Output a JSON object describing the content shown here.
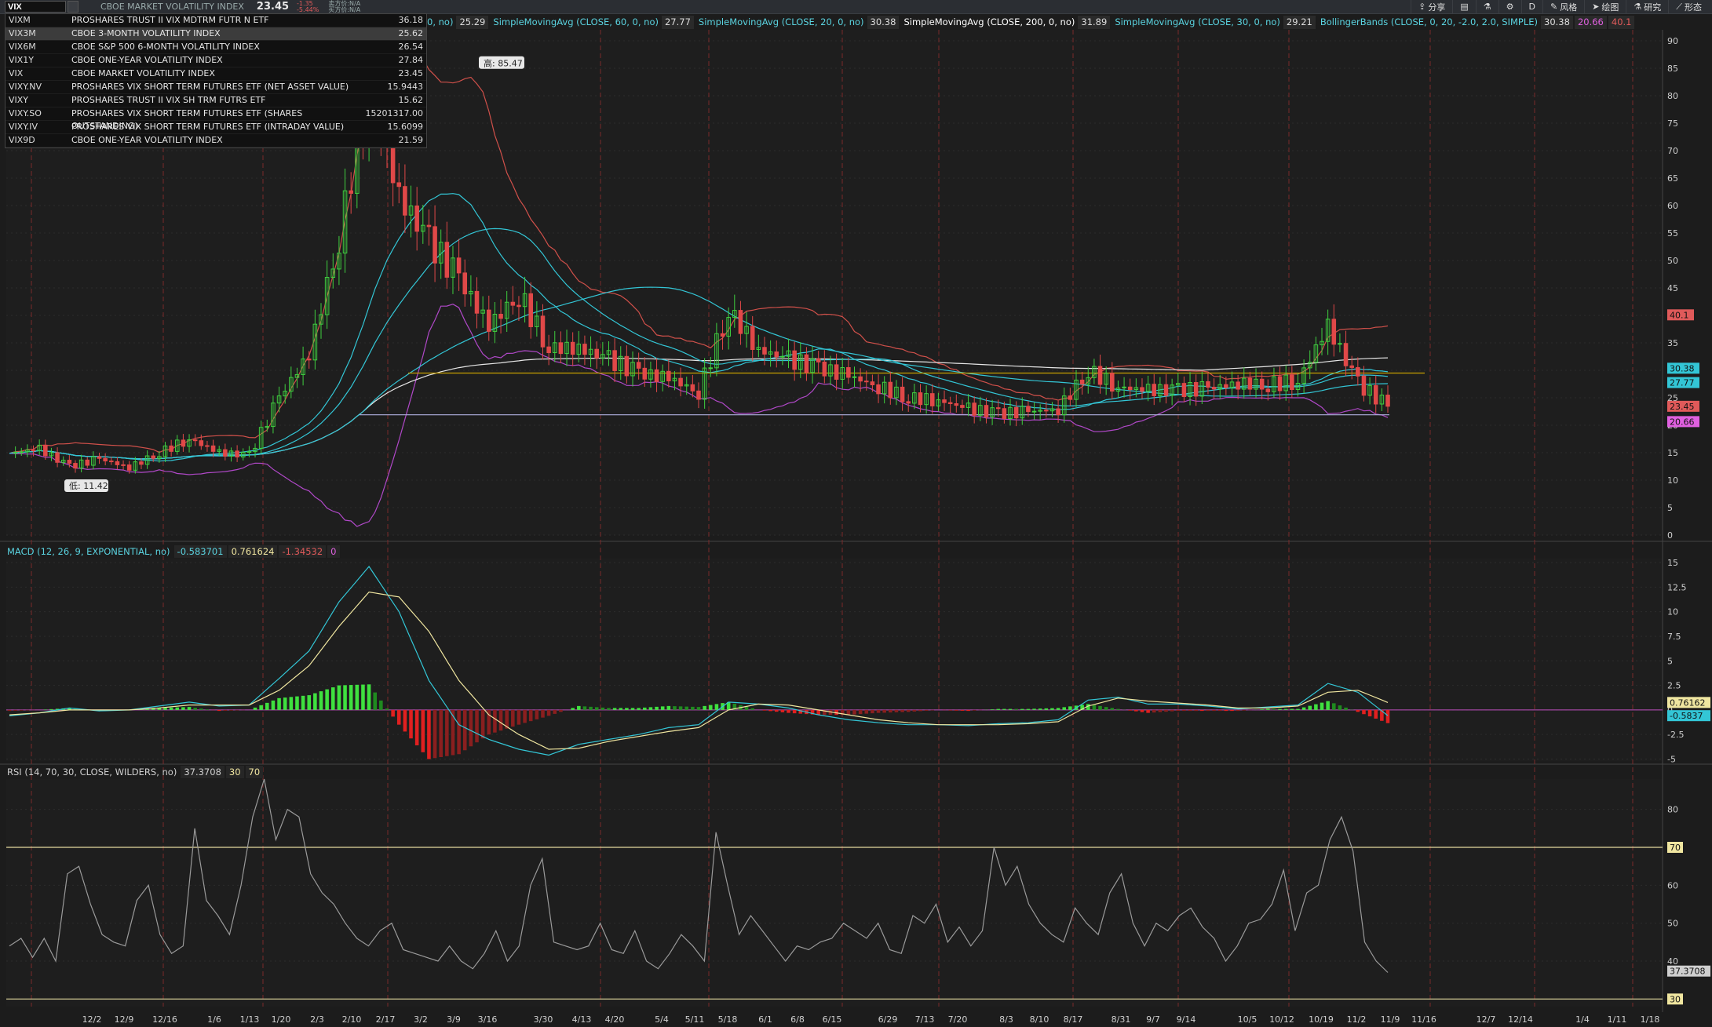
{
  "header": {
    "symbol_input": "VIX",
    "symbol_name": "CBOE MARKET VOLATILITY INDEX",
    "last_price": "23.45",
    "change": "-1.35",
    "change_pct": "-5.44%",
    "bid": "卖方价:N/A",
    "ask": "买方价:N/A",
    "buttons": [
      {
        "label": "分享",
        "icon": "share-icon"
      },
      {
        "label": "",
        "icon": "chart-icon"
      },
      {
        "label": "",
        "icon": "flask-icon"
      },
      {
        "label": "",
        "icon": "gear-icon"
      },
      {
        "label": "D",
        "icon": ""
      },
      {
        "label": "风格",
        "icon": "style-icon"
      },
      {
        "label": "绘图",
        "icon": "cursor-icon"
      },
      {
        "label": "研究",
        "icon": "flask-icon"
      },
      {
        "label": "形态",
        "icon": "pattern-icon"
      }
    ]
  },
  "symbol_list": [
    {
      "symbol": "VIXM",
      "name": "PROSHARES TRUST II VIX MDTRM FUTR N ETF",
      "value": "36.18"
    },
    {
      "symbol": "VIX3M",
      "name": "CBOE 3-MONTH VOLATILITY INDEX",
      "value": "25.62",
      "selected": true
    },
    {
      "symbol": "VIX6M",
      "name": "CBOE S&P 500 6-MONTH VOLATILITY INDEX",
      "value": "26.54"
    },
    {
      "symbol": "VIX1Y",
      "name": "CBOE ONE-YEAR VOLATILITY INDEX",
      "value": "27.84"
    },
    {
      "symbol": "VIX",
      "name": "CBOE MARKET VOLATILITY INDEX",
      "value": "23.45"
    },
    {
      "symbol": "VIXY.NV",
      "name": "PROSHARES VIX SHORT TERM FUTURES ETF (NET ASSET VALUE)",
      "value": "15.9443"
    },
    {
      "symbol": "VIXY",
      "name": "PROSHARES TRUST II VIX SH TRM FUTRS ETF",
      "value": "15.62"
    },
    {
      "symbol": "VIXY.SO",
      "name": "PROSHARES VIX SHORT TERM FUTURES ETF (SHARES OUTSTANDING)",
      "value": "15201317.00"
    },
    {
      "symbol": "VIXY.IV",
      "name": "PROSHARES VIX SHORT TERM FUTURES ETF (INTRADAY VALUE)",
      "value": "15.6099"
    },
    {
      "symbol": "VIX9D",
      "name": "CBOE ONE-YEAR VOLATILITY INDEX",
      "value": "21.59"
    }
  ],
  "study_bar": [
    {
      "text": "0, no)",
      "value": "25.29",
      "color": "#5ad3e0"
    },
    {
      "text": "SimpleMovingAvg (CLOSE, 60, 0, no)",
      "value": "27.77",
      "color": "#5ad3e0"
    },
    {
      "text": "SimpleMovingAvg (CLOSE, 20, 0, no)",
      "value": "30.38",
      "color": "#5ad3e0"
    },
    {
      "text": "SimpleMovingAvg (CLOSE, 200, 0, no)",
      "value": "31.89",
      "color": "#ffffff"
    },
    {
      "text": "SimpleMovingAvg (CLOSE, 30, 0, no)",
      "value": "29.21",
      "color": "#5ad3e0"
    },
    {
      "text": "BollingerBands (CLOSE, 0, 20, -2.0, 2.0, SIMPLE)",
      "value": "30.38",
      "color": "#5ad3e0"
    }
  ],
  "study_bar_extra": [
    {
      "value": "20.66",
      "color": "#e060e0"
    },
    {
      "value": "40.1",
      "color": "#e05a5a"
    }
  ],
  "macd_label": {
    "name": "MACD (12, 26, 9, EXPONENTIAL, no)",
    "values": [
      {
        "v": "-0.583701",
        "color": "#5ad3e0"
      },
      {
        "v": "0.761624",
        "color": "#f0e6a0"
      },
      {
        "v": "-1.34532",
        "color": "#e05a5a"
      },
      {
        "v": "0",
        "color": "#e060e0"
      }
    ]
  },
  "rsi_label": {
    "name": "RSI (14, 70, 30, CLOSE, WILDERS, no)",
    "values": [
      {
        "v": "37.3708",
        "color": "#cfcfcf"
      },
      {
        "v": "30",
        "color": "#f0e6a0"
      },
      {
        "v": "70",
        "color": "#f0e6a0"
      }
    ]
  },
  "chart_data": [
    {
      "type": "candlestick",
      "title": "VIX",
      "x_tick_labels": [
        "12/2",
        "12/9",
        "12/16",
        "1/6",
        "1/13",
        "1/20",
        "2/3",
        "2/10",
        "2/17",
        "3/2",
        "3/9",
        "3/16",
        "3/30",
        "4/13",
        "4/20",
        "5/4",
        "5/11",
        "5/18",
        "6/1",
        "6/8",
        "6/15",
        "6/29",
        "7/13",
        "7/20",
        "8/3",
        "8/10",
        "8/17",
        "8/31",
        "9/7",
        "9/14",
        "10/5",
        "10/12",
        "10/19",
        "11/2",
        "11/9",
        "11/16",
        "12/7",
        "12/14",
        "1/4",
        "1/11",
        "1/18"
      ],
      "y_ticks": [
        0,
        5,
        10,
        15,
        20,
        25,
        30,
        35,
        40,
        45,
        50,
        55,
        60,
        65,
        70,
        75,
        80,
        85,
        90
      ],
      "ylim": [
        0,
        92
      ],
      "annotations": [
        {
          "label": "高: 85.47",
          "value": 85.47
        },
        {
          "label": "低: 11.42",
          "value": 11.42
        }
      ],
      "right_badges": [
        {
          "value": "40.1",
          "color": "#e05a5a"
        },
        {
          "value": "30.38",
          "color": "#33c6d6"
        },
        {
          "value": "27.77",
          "color": "#33c6d6"
        },
        {
          "value": "23.45",
          "color": "#e05a5a"
        },
        {
          "value": "20.66",
          "color": "#e060e0"
        }
      ],
      "horizontal_lines": [
        {
          "value": 29.5,
          "color": "#c8a000"
        },
        {
          "value": 21.9,
          "color": "#b0b0e0"
        }
      ],
      "close_series": [
        {
          "x": "12/2",
          "y": 14.9
        },
        {
          "x": "12/9",
          "y": 15.7
        },
        {
          "x": "12/16",
          "y": 12.5
        },
        {
          "x": "1/6",
          "y": 13.9
        },
        {
          "x": "1/13",
          "y": 12.3
        },
        {
          "x": "1/20",
          "y": 15.0
        },
        {
          "x": "2/3",
          "y": 17.5
        },
        {
          "x": "2/10",
          "y": 15.0
        },
        {
          "x": "2/17",
          "y": 14.5
        },
        {
          "x": "2/24",
          "y": 25.0
        },
        {
          "x": "3/2",
          "y": 33.0
        },
        {
          "x": "3/9",
          "y": 54.0
        },
        {
          "x": "3/16",
          "y": 82.7
        },
        {
          "x": "3/23",
          "y": 61.6
        },
        {
          "x": "3/30",
          "y": 53.5
        },
        {
          "x": "4/6",
          "y": 46.7
        },
        {
          "x": "4/13",
          "y": 38.1
        },
        {
          "x": "4/20",
          "y": 43.8
        },
        {
          "x": "4/27",
          "y": 34.1
        },
        {
          "x": "5/4",
          "y": 34.0
        },
        {
          "x": "5/11",
          "y": 32.0
        },
        {
          "x": "5/18",
          "y": 29.5
        },
        {
          "x": "5/25",
          "y": 28.6
        },
        {
          "x": "6/1",
          "y": 26.0
        },
        {
          "x": "6/8",
          "y": 41.0
        },
        {
          "x": "6/15",
          "y": 33.7
        },
        {
          "x": "6/22",
          "y": 32.0
        },
        {
          "x": "6/29",
          "y": 30.4
        },
        {
          "x": "7/6",
          "y": 29.0
        },
        {
          "x": "7/13",
          "y": 27.0
        },
        {
          "x": "7/20",
          "y": 25.0
        },
        {
          "x": "7/27",
          "y": 24.5
        },
        {
          "x": "8/3",
          "y": 23.0
        },
        {
          "x": "8/10",
          "y": 22.1
        },
        {
          "x": "8/17",
          "y": 22.5
        },
        {
          "x": "8/24",
          "y": 22.9
        },
        {
          "x": "8/31",
          "y": 30.0
        },
        {
          "x": "9/7",
          "y": 26.9
        },
        {
          "x": "9/14",
          "y": 26.4
        },
        {
          "x": "9/21",
          "y": 26.4
        },
        {
          "x": "9/28",
          "y": 26.7
        },
        {
          "x": "10/5",
          "y": 27.6
        },
        {
          "x": "10/12",
          "y": 27.4
        },
        {
          "x": "10/19",
          "y": 28.0
        },
        {
          "x": "10/26",
          "y": 38.0
        },
        {
          "x": "11/2",
          "y": 27.6
        },
        {
          "x": "11/9",
          "y": 23.45
        }
      ]
    },
    {
      "type": "line",
      "title": "MACD (12, 26, 9, EXPONENTIAL, no)",
      "y_ticks": [
        -5,
        -2.5,
        0,
        2.5,
        5,
        7.5,
        10,
        12.5,
        15
      ],
      "ylim": [
        -5.2,
        15.4
      ],
      "right_badges": [
        {
          "value": "0.76162",
          "color": "#f0e6a0"
        },
        {
          "value": "-0.5837",
          "color": "#33c6d6"
        }
      ],
      "series": [
        {
          "name": "Value",
          "values": [
            -0.6,
            -0.3,
            0.2,
            -0.1,
            0.0,
            0.4,
            0.8,
            0.4,
            0.5,
            3.2,
            6.0,
            11.0,
            14.6,
            10.0,
            3.0,
            -1.5,
            -3.0,
            -4.0,
            -4.6,
            -3.5,
            -3.0,
            -2.5,
            -1.8,
            -1.5,
            0.8,
            0.6,
            0.2,
            -0.5,
            -1.0,
            -1.3,
            -1.5,
            -1.5,
            -1.6,
            -1.4,
            -1.3,
            -1.0,
            1.0,
            1.3,
            0.6,
            0.6,
            0.4,
            0.1,
            0.3,
            0.5,
            2.7,
            1.8,
            -0.58
          ]
        },
        {
          "name": "Avg",
          "values": [
            -0.5,
            -0.3,
            0.0,
            0.0,
            0.0,
            0.2,
            0.5,
            0.5,
            0.5,
            2.0,
            4.5,
            8.5,
            12.0,
            11.5,
            8.0,
            3.0,
            -0.5,
            -2.5,
            -4.0,
            -3.9,
            -3.2,
            -2.7,
            -2.2,
            -1.8,
            0.0,
            0.6,
            0.5,
            0.0,
            -0.5,
            -1.0,
            -1.3,
            -1.5,
            -1.5,
            -1.5,
            -1.4,
            -1.2,
            0.4,
            1.2,
            0.9,
            0.7,
            0.5,
            0.2,
            0.2,
            0.4,
            1.8,
            2.0,
            0.76
          ]
        }
      ]
    },
    {
      "type": "line",
      "title": "RSI (14, 70, 30, CLOSE, WILDERS, no)",
      "y_ticks": [
        30,
        40,
        50,
        60,
        70,
        80
      ],
      "ylim": [
        28,
        88
      ],
      "right_badges": [
        {
          "value": "70",
          "color": "#f0e6a0"
        },
        {
          "value": "37.3708",
          "color": "#cfcfcf"
        },
        {
          "value": "30",
          "color": "#f0e6a0"
        }
      ],
      "series": [
        {
          "name": "RSI",
          "values": [
            44,
            46,
            41,
            46,
            40,
            63,
            65,
            55,
            47,
            45,
            44,
            56,
            60,
            47,
            42,
            44,
            75,
            56,
            52,
            47,
            60,
            78,
            88,
            72,
            80,
            78,
            63,
            58,
            55,
            50,
            46,
            44,
            48,
            50,
            43,
            42,
            41,
            40,
            44,
            40,
            38,
            42,
            48,
            40,
            44,
            60,
            67,
            45,
            44,
            43,
            44,
            50,
            43,
            42,
            48,
            40,
            38,
            42,
            47,
            44,
            40,
            74,
            60,
            47,
            52,
            48,
            44,
            40,
            44,
            43,
            45,
            46,
            50,
            48,
            46,
            50,
            43,
            42,
            52,
            50,
            55,
            45,
            49,
            44,
            48,
            70,
            60,
            65,
            55,
            50,
            47,
            45,
            54,
            50,
            47,
            58,
            63,
            50,
            44,
            50,
            48,
            52,
            54,
            49,
            46,
            40,
            44,
            50,
            51,
            55,
            64,
            48,
            58,
            60,
            72,
            78,
            69,
            45,
            40,
            37
          ]
        }
      ]
    }
  ]
}
